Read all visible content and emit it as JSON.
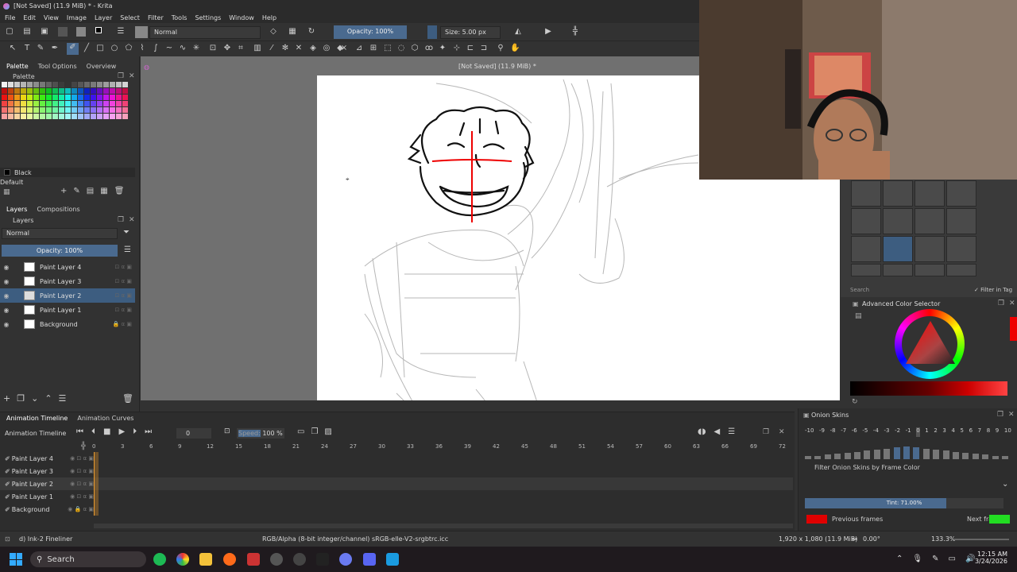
{
  "window": {
    "title": "[Not Saved]  (11.9 MiB) * - Krita"
  },
  "menu": [
    "File",
    "Edit",
    "View",
    "Image",
    "Layer",
    "Select",
    "Filter",
    "Tools",
    "Settings",
    "Window",
    "Help"
  ],
  "toolbar": {
    "blend_mode": "Normal",
    "opacity": "Opacity: 100%",
    "size": "Size: 5.00 px"
  },
  "left_tabs": [
    "Palette",
    "Tool Options",
    "Overview"
  ],
  "palette": {
    "title": "Palette",
    "current_color": "Black",
    "preset": "Default"
  },
  "layers_panel": {
    "tabs": [
      "Layers",
      "Compositions"
    ],
    "title": "Layers",
    "blend": "Normal",
    "opacity": "Opacity:  100%",
    "layers": [
      {
        "name": "Paint Layer 4",
        "selected": false
      },
      {
        "name": "Paint Layer 3",
        "selected": false
      },
      {
        "name": "Paint Layer 2",
        "selected": true
      },
      {
        "name": "Paint Layer 1",
        "selected": false
      },
      {
        "name": "Background",
        "selected": false
      }
    ]
  },
  "canvas": {
    "title": "[Not Saved]  (11.9 MiB) *"
  },
  "brushes": {
    "search_placeholder": "Search",
    "filter_label": "Filter in Tag"
  },
  "color_selector": {
    "title": "Advanced Color Selector"
  },
  "timeline": {
    "tabs": [
      "Animation Timeline",
      "Animation Curves"
    ],
    "title": "Animation Timeline",
    "frame": "0",
    "speed_label": "Speed:",
    "speed": "100 %",
    "ruler": [
      "0",
      "3",
      "6",
      "9",
      "12",
      "15",
      "18",
      "21",
      "24",
      "27",
      "30",
      "33",
      "36",
      "39",
      "42",
      "45",
      "48",
      "51",
      "54",
      "57",
      "60",
      "63",
      "66",
      "69",
      "72"
    ],
    "layers": [
      "Paint Layer 4",
      "Paint Layer 3",
      "Paint Layer 2",
      "Paint Layer 1",
      "Background"
    ]
  },
  "onion": {
    "title": "Onion Skins",
    "numbers": [
      "-10",
      "-9",
      "-8",
      "-7",
      "-6",
      "-5",
      "-4",
      "-3",
      "-2",
      "-1",
      "0",
      "1",
      "2",
      "3",
      "4",
      "5",
      "6",
      "7",
      "8",
      "9",
      "10"
    ],
    "filter_label": "Filter Onion Skins by Frame Color",
    "tint": "Tint: 71.00%",
    "previous": "Previous frames",
    "next": "Next frames",
    "prev_color": "#e00000",
    "next_color": "#22dd22"
  },
  "status": {
    "brush": "d) Ink-2 Fineliner",
    "color_space": "RGB/Alpha (8-bit integer/channel)  sRGB-elle-V2-srgbtrc.icc",
    "dims": "1,920 x 1,080 (11.9 MiB)",
    "rotation": "0.00°",
    "zoom": "133.3%"
  },
  "taskbar": {
    "search": "Search",
    "time": "12:15 AM",
    "date": "3/24/2026"
  }
}
